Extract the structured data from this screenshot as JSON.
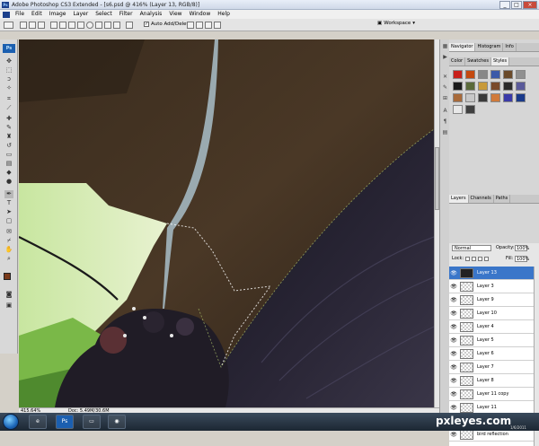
{
  "window": {
    "title": "Adobe Photoshop CS3 Extended - [s6.psd @ 416% (Layer 13, RGB/8)]",
    "controls": [
      "_",
      "□",
      "×"
    ]
  },
  "menu": [
    "File",
    "Edit",
    "Image",
    "Layer",
    "Select",
    "Filter",
    "Analysis",
    "View",
    "Window",
    "Help"
  ],
  "options": {
    "auto_add_delete_label": "Auto Add/Delete",
    "auto_add_delete_checked": "✓",
    "workspace_label": "Workspace"
  },
  "panels": {
    "top_tabs": [
      "Navigator",
      "Histogram",
      "Info"
    ],
    "style_tabs": [
      "Color",
      "Swatches",
      "Styles"
    ],
    "layer_tabs": [
      "Layers",
      "Channels",
      "Paths"
    ],
    "style_swatch_colors": [
      "#c8201a",
      "#c44a10",
      "#888888",
      "#3c5aa8",
      "#6a4a2a",
      "#909090",
      "#1a1a1a",
      "#5a6a3a",
      "#c89a3a",
      "#7a4a2a",
      "#2a2a2a",
      "#5a5a9a",
      "#a86a3a",
      "#c8c8c8",
      "#3a3a3a",
      "#d07a3a",
      "#3a3aa8",
      "#1a3a8a",
      "#e8e8e8",
      "#404040"
    ]
  },
  "layers": {
    "blend_mode": "Normal",
    "opacity_label": "Opacity:",
    "opacity_value": "100%",
    "lock_label": "Lock:",
    "fill_label": "Fill:",
    "fill_value": "100%",
    "items": [
      "Layer 13",
      "Layer 3",
      "Layer 9",
      "Layer 10",
      "Layer 4",
      "Layer 5",
      "Layer 6",
      "Layer 7",
      "Layer 8",
      "Layer 11 copy",
      "Layer 11",
      "Layer 12",
      "bird reflection"
    ],
    "selected_index": 0
  },
  "status": {
    "zoom": "415.64%",
    "doc": "Doc: 5.49M/30.6M"
  },
  "watermark": {
    "site": "pxleyes.com",
    "date": "1/6/2011"
  }
}
